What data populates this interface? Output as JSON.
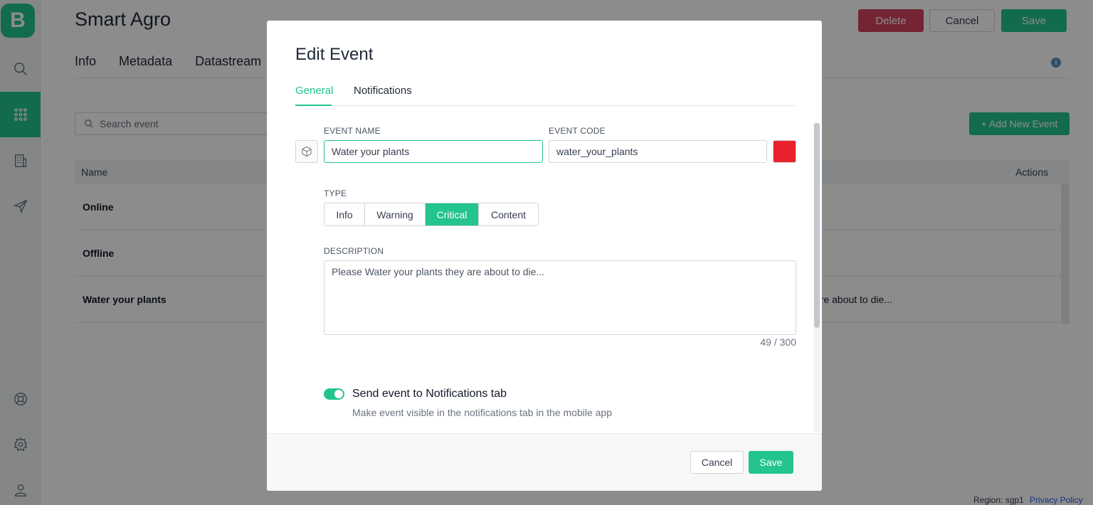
{
  "app": {
    "logo_letter": "B",
    "title": "Smart Agro"
  },
  "sidebar": {
    "items": [
      {
        "icon": "search-icon"
      },
      {
        "icon": "grid-icon",
        "active": true
      },
      {
        "icon": "building-icon"
      },
      {
        "icon": "send-icon"
      },
      {
        "icon": "lifebuoy-icon"
      },
      {
        "icon": "gear-icon"
      },
      {
        "icon": "user-icon"
      }
    ]
  },
  "header": {
    "delete_label": "Delete",
    "cancel_label": "Cancel",
    "save_label": "Save",
    "tabs": [
      {
        "label": "Info"
      },
      {
        "label": "Metadata"
      },
      {
        "label": "Datastream"
      }
    ]
  },
  "events": {
    "search_placeholder": "Search event",
    "add_label": "+ Add New Event",
    "columns": {
      "name": "Name",
      "actions": "Actions"
    },
    "rows": [
      {
        "name": "Online",
        "description": ""
      },
      {
        "name": "Offline",
        "description": ""
      },
      {
        "name": "Water your plants",
        "description": "are about to die..."
      }
    ]
  },
  "modal": {
    "title": "Edit Event",
    "tabs": [
      {
        "label": "General",
        "active": true
      },
      {
        "label": "Notifications"
      }
    ],
    "event_name_label": "EVENT NAME",
    "event_name_value": "Water your plants",
    "event_code_label": "EVENT CODE",
    "event_code_value": "water_your_plants",
    "color": "#e8212c",
    "type_label": "TYPE",
    "types": [
      {
        "label": "Info"
      },
      {
        "label": "Warning"
      },
      {
        "label": "Critical",
        "selected": true
      },
      {
        "label": "Content"
      }
    ],
    "description_label": "DESCRIPTION",
    "description_value": "Please Water your plants they are about to die...",
    "char_counter": "49 / 300",
    "notify_toggle_label": "Send event to Notifications tab",
    "notify_toggle_on": true,
    "notify_toggle_sub": "Make event visible in the notifications tab in the mobile app",
    "cancel_label": "Cancel",
    "save_label": "Save"
  },
  "footer": {
    "region": "Region: sgp1",
    "privacy": "Privacy Policy"
  },
  "colors": {
    "accent": "#23c48e",
    "danger": "#d3435c"
  }
}
